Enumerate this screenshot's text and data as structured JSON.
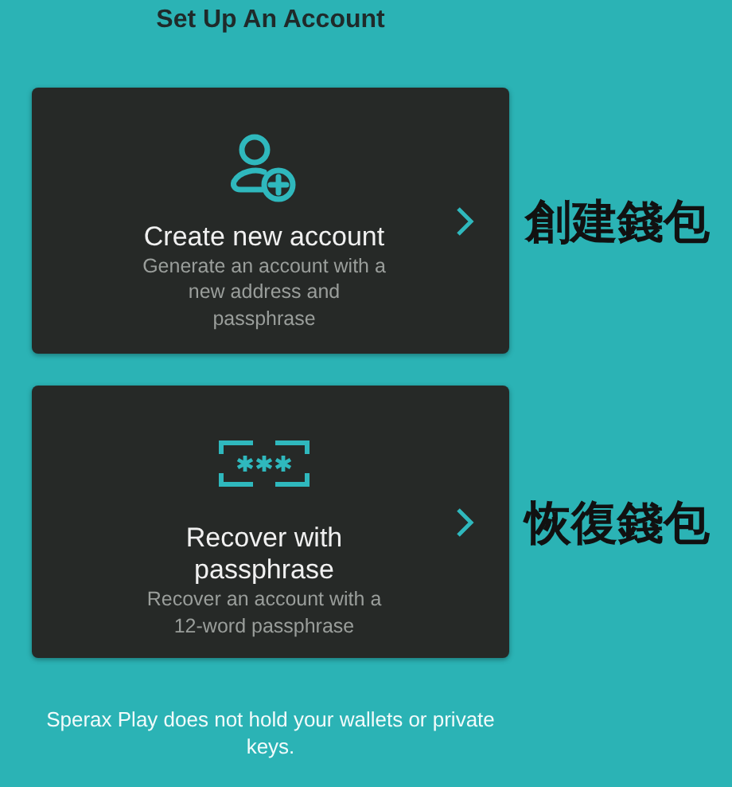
{
  "title": "Set Up An Account",
  "options": [
    {
      "kind": "create",
      "title": "Create new account",
      "description": "Generate an account with a new address and passphrase",
      "annotation": "創建錢包"
    },
    {
      "kind": "recover",
      "title": "Recover with passphrase",
      "description": "Recover an account with a 12-word passphrase",
      "annotation": "恢復錢包"
    }
  ],
  "footer": "Sperax Play does not hold your wallets or private keys."
}
